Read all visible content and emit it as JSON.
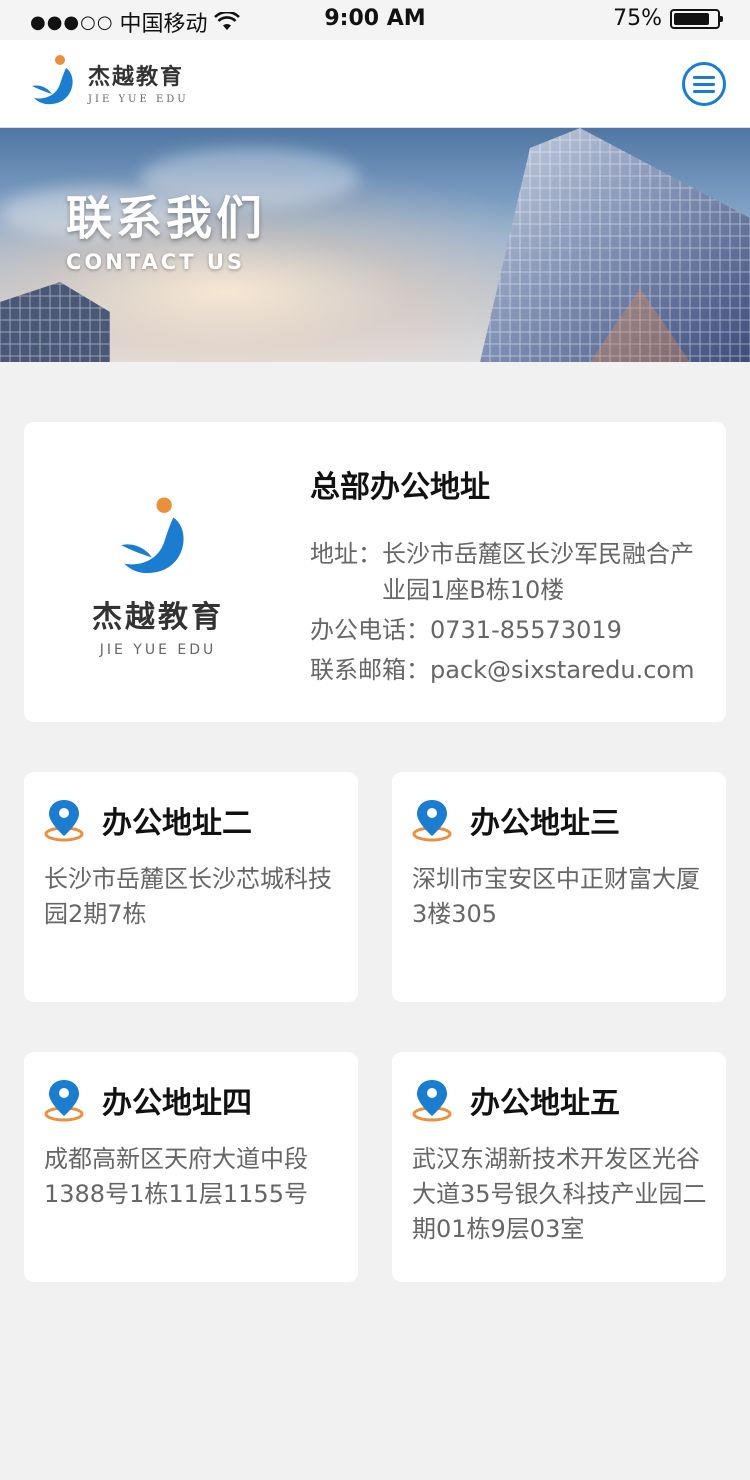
{
  "status_bar": {
    "carrier": "中国移动",
    "time": "9:00 AM",
    "battery": "75%"
  },
  "header": {
    "brand_cn": "杰越教育",
    "brand_en": "JIE YUE EDU",
    "menu_icon": "hamburger-menu-icon"
  },
  "hero": {
    "title": "联系我们",
    "subtitle": "CONTACT US"
  },
  "headquarters": {
    "logo_cn": "杰越教育",
    "logo_en": "JIE YUE EDU",
    "title": "总部办公地址",
    "address_label": "地址：",
    "address_value": "长沙市岳麓区长沙军民融合产业园1座B栋10楼",
    "phone_label": "办公电话：",
    "phone_value": "0731-85573019",
    "email_label": "联系邮箱：",
    "email_value": "pack@sixstaredu.com"
  },
  "offices": [
    {
      "name": "办公地址二",
      "address": "长沙市岳麓区长沙芯城科技园2期7栋"
    },
    {
      "name": "办公地址三",
      "address": "深圳市宝安区中正财富大厦3楼305"
    },
    {
      "name": "办公地址四",
      "address": "成都高新区天府大道中段1388号1栋11层1155号"
    },
    {
      "name": "办公地址五",
      "address": "武汉东湖新技术开发区光谷大道35号银久科技产业园二期01栋9层03室"
    }
  ],
  "colors": {
    "accent_blue": "#1b7dd0",
    "accent_orange": "#e8903a",
    "background": "#f1f1f1"
  }
}
